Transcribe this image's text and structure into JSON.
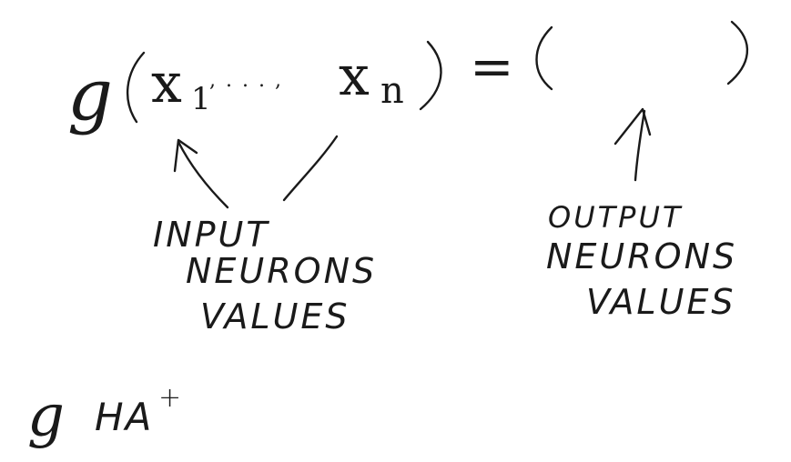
{
  "formula": {
    "function_name": "g",
    "arg_first": "x",
    "arg_first_sub": "1",
    "arg_sep": ", . . . ,",
    "arg_last": "x",
    "arg_last_sub": "n",
    "equals": "="
  },
  "input_label": {
    "line1": "INPUT",
    "line2": "NEURONS",
    "line3": "VALUES"
  },
  "output_label": {
    "line1": "OUTPUT",
    "line2": "NEURONS",
    "line3": "VALUES"
  },
  "footnote": {
    "symbol": "g",
    "text": "HA",
    "superscript": "+"
  },
  "colors": {
    "ink": "#1a1a1a",
    "background": "#ffffff"
  }
}
